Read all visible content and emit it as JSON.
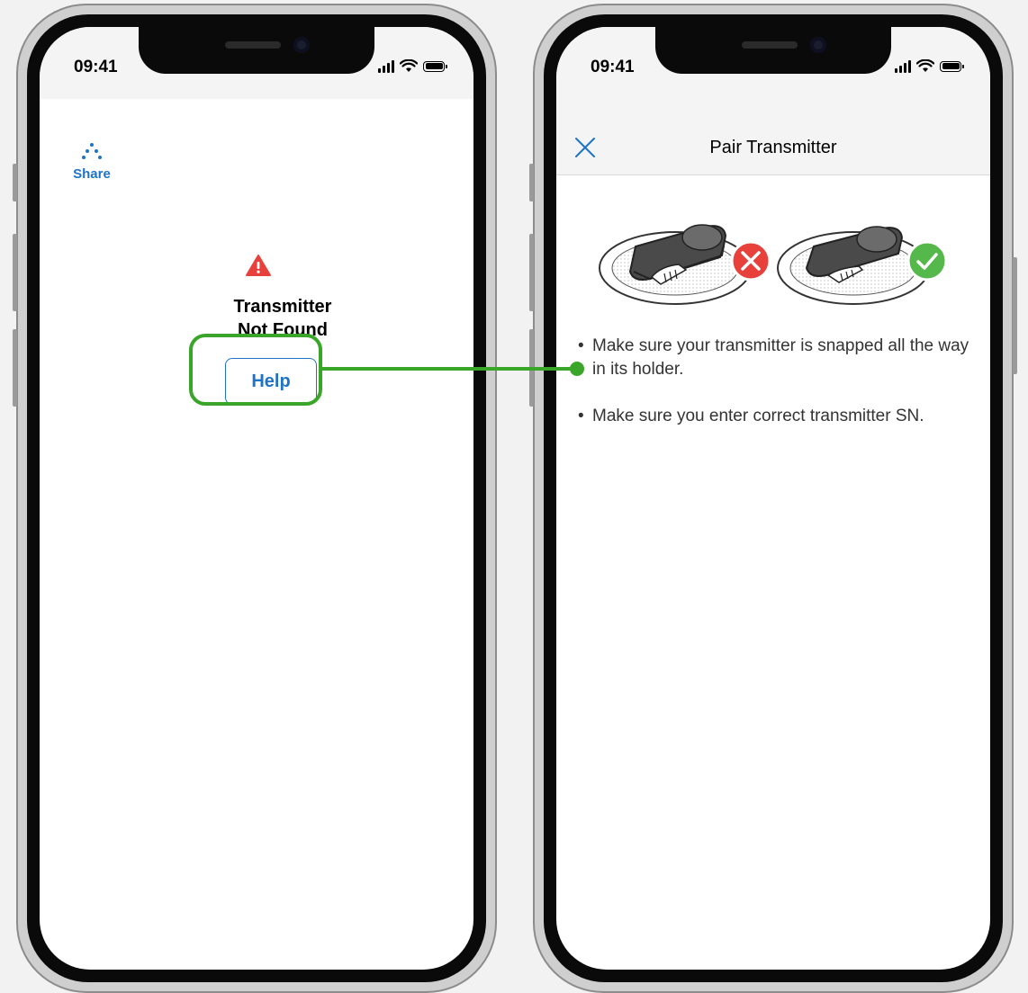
{
  "left_phone": {
    "status_time": "09:41",
    "share_label": "Share",
    "error_title_line1": "Transmitter",
    "error_title_line2": "Not Found",
    "help_label": "Help"
  },
  "right_phone": {
    "status_time": "09:41",
    "title": "Pair Transmitter",
    "bullets": [
      "Make sure your transmitter is snapped all the way in its holder.",
      "Make sure you enter correct transmitter SN."
    ]
  },
  "colors": {
    "accent_blue": "#1e73c8",
    "highlight_green": "#3aa629",
    "warning_red": "#e8413b",
    "error_red": "#e8413b",
    "success_green": "#55b84a"
  },
  "icons": {
    "share": "share-icon",
    "warning": "warning-icon",
    "close": "close-icon",
    "wrong": "x-circle-icon",
    "correct": "check-circle-icon"
  }
}
